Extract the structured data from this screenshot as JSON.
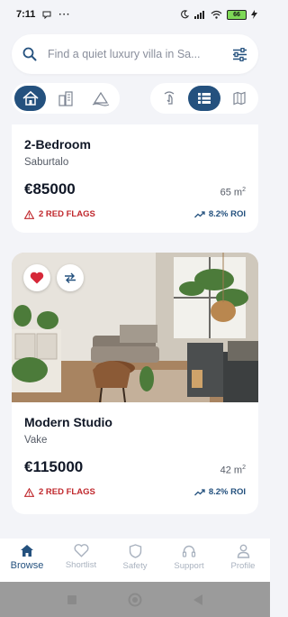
{
  "status_bar": {
    "time": "7:11",
    "battery": "66"
  },
  "search": {
    "placeholder": "Find a quiet luxury villa in Sa..."
  },
  "colors": {
    "accent": "#24517e",
    "red_flag": "#c0282d",
    "favorite": "#d62839"
  },
  "listings": [
    {
      "title": "2-Bedroom",
      "location": "Saburtalo",
      "price": "€85000",
      "area": "65 m",
      "area_unit_sup": "2",
      "red_flags": "2 RED FLAGS",
      "roi": "8.2% ROI"
    },
    {
      "title": "Modern Studio",
      "location": "Vake",
      "price": "€115000",
      "area": "42 m",
      "area_unit_sup": "2",
      "red_flags": "2 RED FLAGS",
      "roi": "8.2% ROI",
      "favorited": true
    }
  ],
  "bottom_nav": [
    {
      "label": "Browse",
      "icon": "home-icon",
      "active": true
    },
    {
      "label": "Shortlist",
      "icon": "heart-icon"
    },
    {
      "label": "Safety",
      "icon": "shield-icon"
    },
    {
      "label": "Support",
      "icon": "headset-icon"
    },
    {
      "label": "Profile",
      "icon": "person-icon"
    }
  ]
}
